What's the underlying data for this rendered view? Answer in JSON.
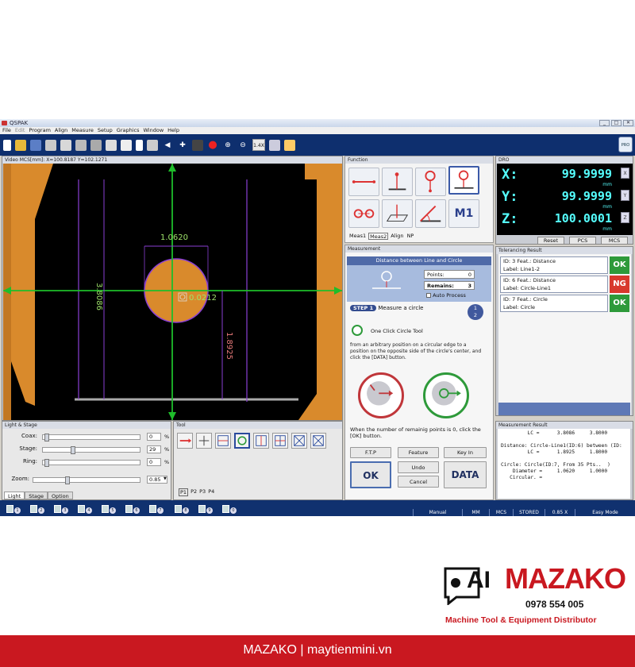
{
  "app": {
    "title": "QSPAK",
    "window_buttons": [
      "_",
      "□",
      "✕"
    ]
  },
  "menu": [
    "File",
    "Edit",
    "Program",
    "Align",
    "Measure",
    "Setup",
    "Graphics",
    "Window",
    "Help"
  ],
  "toolbar": {
    "zoom_label": "1.4X",
    "pro_label": "PRO"
  },
  "video": {
    "header": "Video   MCS[mm]: X=100.8187 Y=102.1271",
    "dimensions": {
      "diameter": "1.0620",
      "height_left": "3.8086",
      "height_right": "1.8925",
      "circularity": "0.0212"
    }
  },
  "function": {
    "header": "Function",
    "m1_label": "M1",
    "tabs": [
      "Meas1",
      "Meas2",
      "Align",
      "NP"
    ],
    "active_tab": "Meas2"
  },
  "measurement": {
    "header": "Measurement",
    "title": "Distance between Line and Circle",
    "points_label": "Points:",
    "points_value": "0",
    "remains_label": "Remains:",
    "remains_value": "3",
    "auto_process": "Auto Process",
    "step_badge": "STEP 1",
    "step_text": "Measure a circle",
    "step_num": "1",
    "step_total": "2",
    "tool_name": "One Click Circle Tool",
    "description": "from an arbitrary position on a circular edge to a position on the opposite side of the circle's center, and click the [DATA] button.",
    "hint": "When the number of remainig points is 0, click the [OK] button.",
    "buttons": {
      "ftp": "F.T.P",
      "feature": "Feature",
      "keyin": "Key In",
      "ok": "OK",
      "undo": "Undo",
      "cancel": "Cancel",
      "data": "DATA"
    }
  },
  "dro": {
    "header": "DRO",
    "x_label": "X:",
    "x_value": "99.9999",
    "y_label": "Y:",
    "y_value": "99.9999",
    "z_label": "Z:",
    "z_value": "100.0001",
    "unit": "mm",
    "zero_x": "X",
    "zero_y": "Y",
    "zero_z": "Z",
    "buttons": [
      "Reset",
      "PCS",
      "MCS"
    ]
  },
  "tolerancing": {
    "header": "Tolerancing Result",
    "rows": [
      {
        "line1": "ID: 3     Feat.: Distance",
        "line2": "Label: Line1-2",
        "status": "OK",
        "color": "#2e9a3a"
      },
      {
        "line1": "ID: 6     Feat.: Distance",
        "line2": "Label: Circle-Line1",
        "status": "NG",
        "color": "#d8392d"
      },
      {
        "line1": "ID: 7     Feat.: Circle",
        "line2": "Label: Circle",
        "status": "OK",
        "color": "#2e9a3a"
      }
    ]
  },
  "measurement_result": {
    "header": "Measurement Result",
    "text": "         LC =      3.8086     3.8000\n\nDistance: Circle-Line1(ID:6) between (ID:\n         LC =      1.8925     1.8000\n\nCircle: Circle(ID:7, From 35 Pts..  )\n    Diameter =     1.0620     1.0000\n   Circular. ="
  },
  "light": {
    "header": "Light & Stage",
    "rows": [
      {
        "label": "Coax:",
        "value": "0",
        "unit": "%",
        "level": 0.0
      },
      {
        "label": "Stage:",
        "value": "29",
        "unit": "%",
        "level": 0.29
      },
      {
        "label": "Ring:",
        "value": "0",
        "unit": "%",
        "level": 0.0
      },
      {
        "label": "Zoom:",
        "value": "0.85",
        "unit": "",
        "level": 0.3
      }
    ],
    "tabs": [
      "Light",
      "Stage",
      "Option"
    ]
  },
  "tool": {
    "header": "Tool",
    "pages": [
      "P1",
      "P2",
      "P3",
      "P4"
    ]
  },
  "status": [
    "Manual",
    "MM",
    "MCS",
    "STORED",
    "0.85 X",
    "Easy Mode"
  ],
  "brand": {
    "name": "MAZAKO",
    "phone": "0978 554 005",
    "tagline": "Machine Tool & Equipment Distributor",
    "ai": "AI"
  },
  "footer": "MAZAKO | maytienmini.vn",
  "colors": {
    "accent": "#0e2f6e",
    "brand_red": "#c91820",
    "dro_text": "#55ffff"
  }
}
